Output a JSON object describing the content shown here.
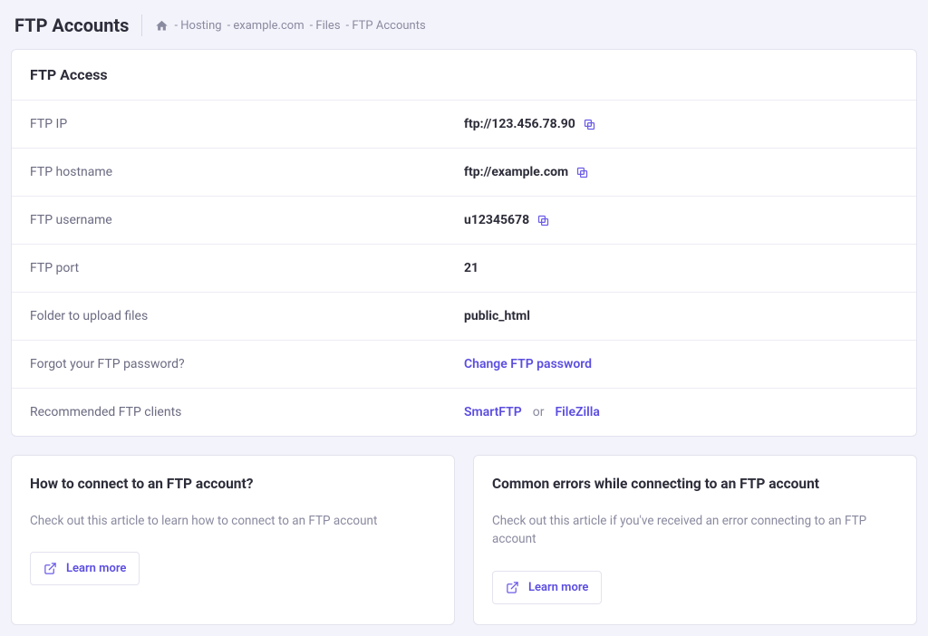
{
  "header": {
    "title": "FTP Accounts",
    "breadcrumb": [
      "- Hosting",
      "- example.com",
      "- Files",
      "- FTP Accounts"
    ]
  },
  "card": {
    "title": "FTP Access",
    "rows": {
      "ip": {
        "label": "FTP IP",
        "value": "ftp://123.456.78.90"
      },
      "hostname": {
        "label": "FTP hostname",
        "value": "ftp://example.com"
      },
      "username": {
        "label": "FTP username",
        "value": "u12345678"
      },
      "port": {
        "label": "FTP port",
        "value": "21"
      },
      "folder": {
        "label": "Folder to upload files",
        "value": "public_html"
      },
      "forgot": {
        "label": "Forgot your FTP password?",
        "link": "Change FTP password"
      },
      "clients": {
        "label": "Recommended FTP clients",
        "link1": "SmartFTP",
        "or": "or",
        "link2": "FileZilla"
      }
    }
  },
  "info": {
    "connect": {
      "title": "How to connect to an FTP account?",
      "desc": "Check out this article to learn how to connect to an FTP account",
      "btn": "Learn more"
    },
    "errors": {
      "title": "Common errors while connecting to an FTP account",
      "desc": "Check out this article if you've received an error connecting to an FTP account",
      "btn": "Learn more"
    }
  }
}
